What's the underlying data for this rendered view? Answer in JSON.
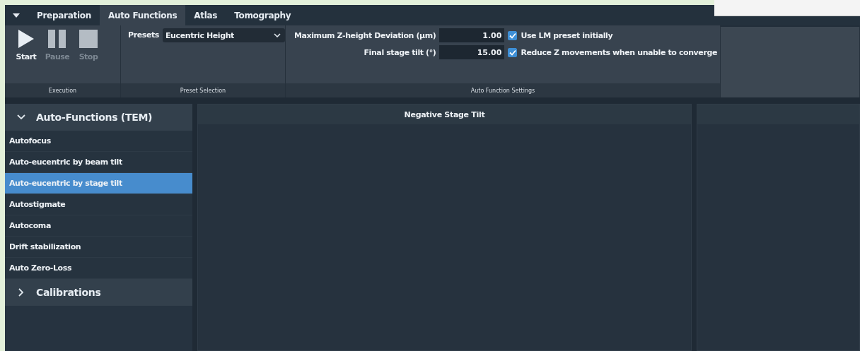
{
  "tabs": [
    {
      "label": "Preparation",
      "selected": false
    },
    {
      "label": "Auto Functions",
      "selected": true
    },
    {
      "label": "Atlas",
      "selected": false
    },
    {
      "label": "Tomography",
      "selected": false
    }
  ],
  "execution": {
    "buttons": [
      {
        "label": "Start",
        "kind": "play",
        "disabled": false
      },
      {
        "label": "Pause",
        "kind": "pause",
        "disabled": true
      },
      {
        "label": "Stop",
        "kind": "stop",
        "disabled": true
      }
    ],
    "group_label": "Execution"
  },
  "preset_selection": {
    "label": "Presets",
    "value": "Eucentric Height",
    "group_label": "Preset Selection"
  },
  "auto_function_settings": {
    "fields": [
      {
        "label": "Maximum Z-height Deviation (µm)",
        "value": "1.00"
      },
      {
        "label": "Final stage tilt (°)",
        "value": "15.00"
      }
    ],
    "checkboxes": [
      {
        "label": "Use LM preset initially",
        "checked": true
      },
      {
        "label": "Reduce Z movements when unable to converge",
        "checked": true
      }
    ],
    "group_label": "Auto Function Settings"
  },
  "sidebar": {
    "sections": [
      {
        "title": "Auto-Functions (TEM)",
        "expanded": true,
        "items": [
          {
            "label": "Autofocus",
            "selected": false
          },
          {
            "label": "Auto-eucentric by beam tilt",
            "selected": false
          },
          {
            "label": "Auto-eucentric by stage tilt",
            "selected": true
          },
          {
            "label": "Autostigmate",
            "selected": false
          },
          {
            "label": "Autocoma",
            "selected": false
          },
          {
            "label": "Drift stabilization",
            "selected": false
          },
          {
            "label": "Auto Zero-Loss",
            "selected": false
          }
        ]
      },
      {
        "title": "Calibrations",
        "expanded": false
      }
    ]
  },
  "center_panel": {
    "title": "Negative Stage Tilt"
  }
}
